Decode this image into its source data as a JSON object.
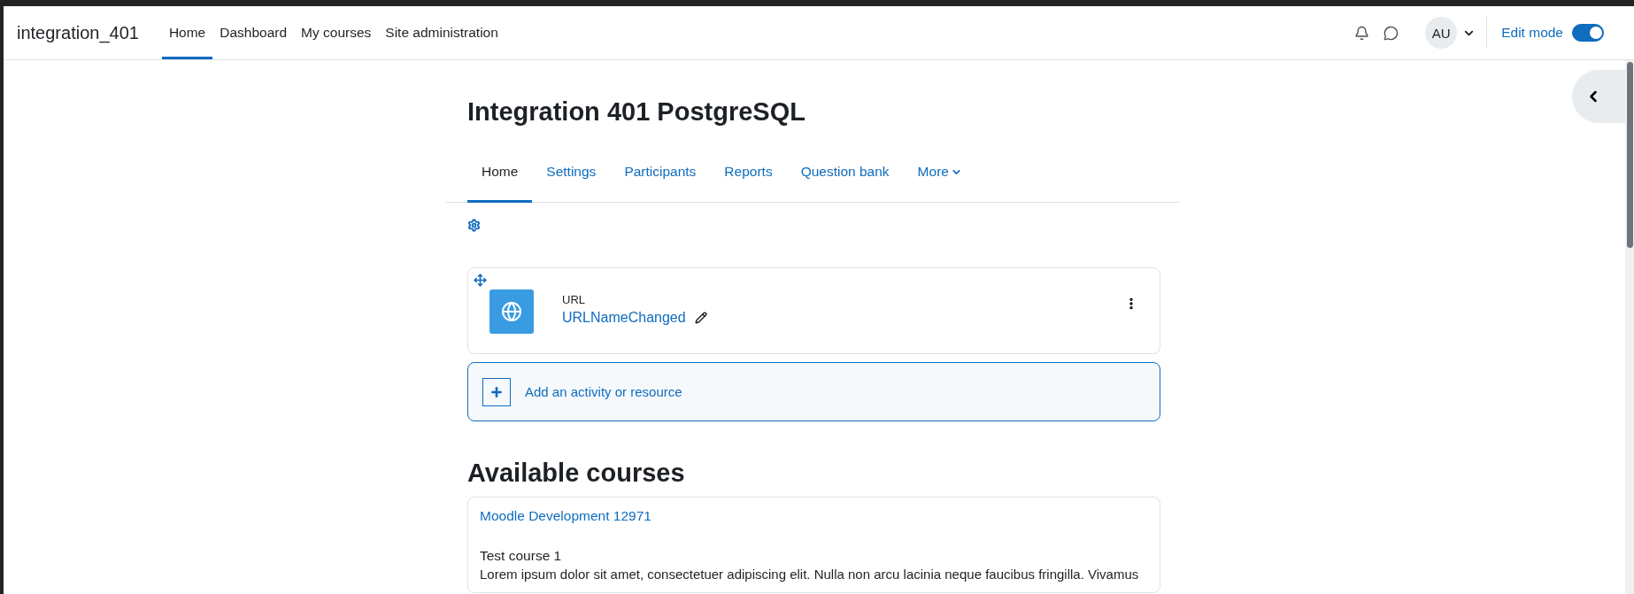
{
  "navbar": {
    "site_name": "integration_401",
    "items": [
      {
        "label": "Home",
        "selected": true
      },
      {
        "label": "Dashboard",
        "selected": false
      },
      {
        "label": "My courses",
        "selected": false
      },
      {
        "label": "Site administration",
        "selected": false
      }
    ],
    "user_initials": "AU",
    "edit_mode": {
      "label": "Edit mode",
      "on": true
    }
  },
  "course": {
    "title": "Integration 401 PostgreSQL",
    "tabs": [
      {
        "label": "Home",
        "selected": true,
        "kind": "link"
      },
      {
        "label": "Settings",
        "selected": false,
        "kind": "link"
      },
      {
        "label": "Participants",
        "selected": false,
        "kind": "link"
      },
      {
        "label": "Reports",
        "selected": false,
        "kind": "link"
      },
      {
        "label": "Question bank",
        "selected": false,
        "kind": "link"
      },
      {
        "label": "More",
        "selected": false,
        "kind": "dropdown"
      }
    ]
  },
  "activity": {
    "type_label": "URL",
    "name": "URLNameChanged"
  },
  "add_activity": {
    "label": "Add an activity or resource"
  },
  "available_courses": {
    "heading": "Available courses",
    "courses": [
      {
        "name": "Moodle Development 12971",
        "summary_title": "Test course 1",
        "summary_text": "Lorem ipsum dolor sit amet, consectetuer adipiscing elit. Nulla non arcu lacinia neque faucibus fringilla. Vivamus"
      }
    ]
  }
}
